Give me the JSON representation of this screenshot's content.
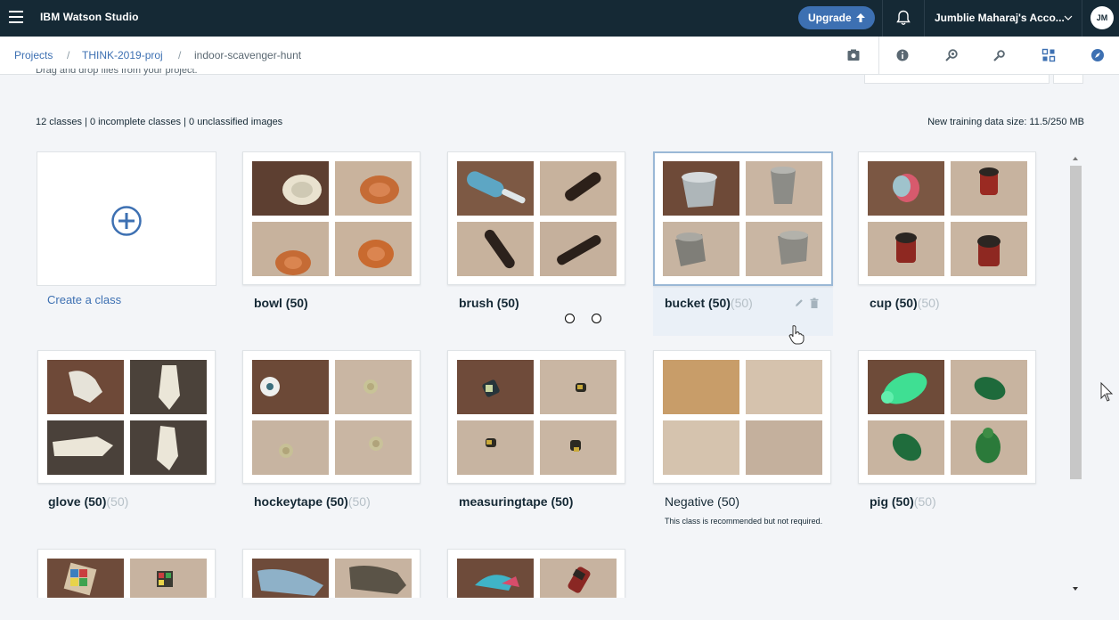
{
  "app": {
    "brand": "IBM Watson Studio"
  },
  "topbar": {
    "upgrade_label": "Upgrade",
    "account_label": "Jumblie Maharaj's Acco...",
    "avatar_initials": "JM"
  },
  "breadcrumb": [
    "Projects",
    "THINK-2019-proj",
    "indoor-scavenger-hunt"
  ],
  "breadcrumb_separator": "/",
  "toolbar": {
    "icons": [
      "screenshot-icon",
      "info-icon",
      "find-icon",
      "search-icon",
      "code-icon",
      "compass-icon"
    ]
  },
  "cut_text": "Drag and drop files from your project.",
  "summary": "12 classes | 0 incomplete classes | 0 unclassified images",
  "datasize": "New training data size: 11.5/250 MB",
  "create_label": "Create a class",
  "classes": [
    {
      "name": "bowl",
      "count": "(50)",
      "ghost": ""
    },
    {
      "name": "brush",
      "count": "(50)",
      "ghost": ""
    },
    {
      "name": "bucket",
      "count": "(50)",
      "ghost": "(50)"
    },
    {
      "name": "cup",
      "count": "(50)",
      "ghost": "(50)"
    },
    {
      "name": "glove",
      "count": "(50)",
      "ghost": "(50)"
    },
    {
      "name": "hockeytape",
      "count": "(50)",
      "ghost": "(50)"
    },
    {
      "name": "measuringtape",
      "count": "(50)",
      "ghost": ""
    },
    {
      "name": "Negative",
      "count": "(50)",
      "ghost": ""
    },
    {
      "name": "pig",
      "count": "(50)",
      "ghost": "(50)"
    }
  ],
  "negative_note": "This class is recommended but not required.",
  "colors": {
    "topbar": "#152935",
    "accent": "#3d70b2",
    "page": "#f3f5f8"
  }
}
